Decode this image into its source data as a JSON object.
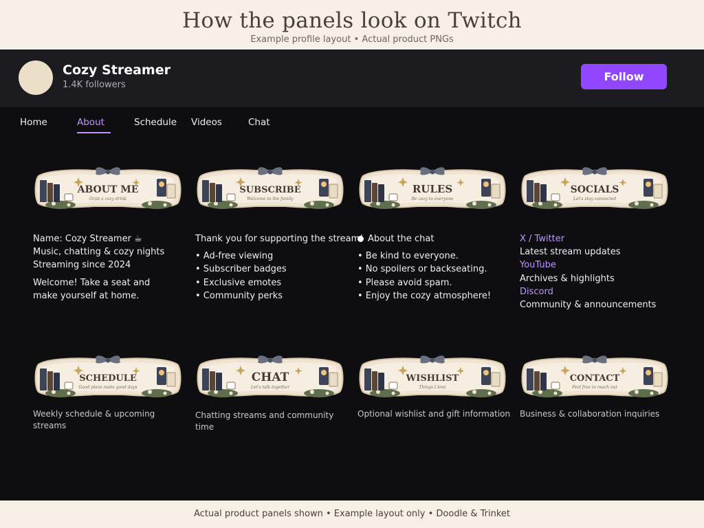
{
  "banner": {
    "title": "How the panels look on Twitch",
    "subtitle": "Example profile layout • Actual product PNGs"
  },
  "profile": {
    "name": "Cozy Streamer",
    "followers": "1.4K followers",
    "follow_label": "Follow"
  },
  "nav": {
    "tabs": [
      {
        "label": "Home",
        "active": false
      },
      {
        "label": "About",
        "active": true
      },
      {
        "label": "Schedule",
        "active": false
      },
      {
        "label": "Videos",
        "active": false
      },
      {
        "label": "Chat",
        "active": false
      }
    ]
  },
  "panels_row1": [
    {
      "banner": "ABOUT ME",
      "tagline": "Grab a cozy drink"
    },
    {
      "banner": "SUBSCRIBE",
      "tagline": "Welcome to the family"
    },
    {
      "banner": "RULES",
      "tagline": "Be cozy to everyone"
    },
    {
      "banner": "SOCIALS",
      "tagline": "Let's stay connected"
    }
  ],
  "about": {
    "lines": [
      "Name: Cozy Streamer ☕",
      "Music, chatting & cozy nights",
      "Streaming since 2024"
    ],
    "welcome_1": "Welcome! Take a seat and",
    "welcome_2": "make yourself at home."
  },
  "subscribe": {
    "intro": "Thank you for supporting the stream!",
    "items": [
      "• Ad-free viewing",
      "• Subscriber badges",
      "• Exclusive emotes",
      "• Community perks"
    ]
  },
  "rules": {
    "heading": "About the chat",
    "items": [
      "• Be kind to everyone.",
      "• No spoilers or backseating.",
      "• Please avoid spam.",
      "• Enjoy the cozy atmosphere!"
    ]
  },
  "socials": [
    {
      "name": "X / Twitter",
      "desc": "Latest stream updates"
    },
    {
      "name": "YouTube",
      "desc": "Archives & highlights"
    },
    {
      "name": "Discord",
      "desc": "Community & announcements"
    }
  ],
  "panels_row2": [
    {
      "banner": "SCHEDULE",
      "tagline": "Good plans make good days",
      "caption": "Weekly schedule & upcoming streams"
    },
    {
      "banner": "CHAT",
      "tagline": "Let's talk together",
      "caption": "Chatting streams and community time"
    },
    {
      "banner": "WISHLIST",
      "tagline": "Things I love",
      "caption": "Optional wishlist and gift information"
    },
    {
      "banner": "CONTACT",
      "tagline": "Feel free to reach out",
      "caption": "Business & collaboration inquiries"
    }
  ],
  "footer": {
    "text": "Actual product panels shown • Example layout only • Doodle & Trinket"
  },
  "colors": {
    "accent": "#9147ff",
    "accent_text": "#bf94ff",
    "page_bg": "#0e0e10",
    "header_bg": "#1b1b20",
    "cream": "#f6f0e6",
    "panel_navy": "#3d4458",
    "panel_brown": "#4a3b30"
  }
}
